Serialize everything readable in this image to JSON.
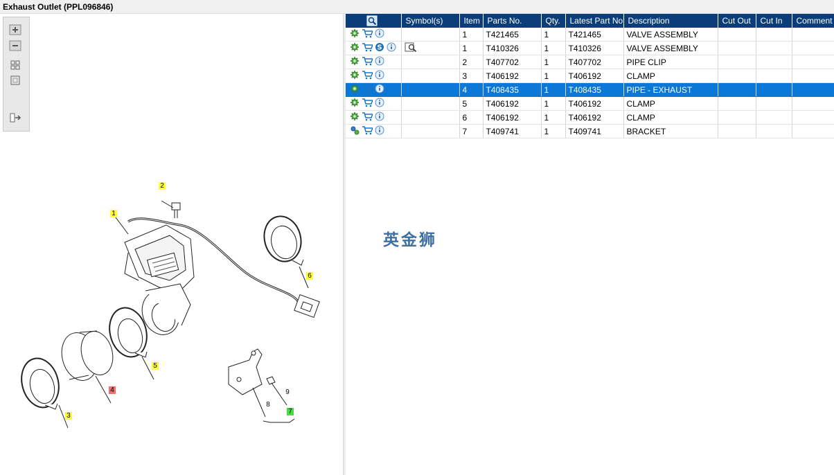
{
  "window": {
    "title": "Exhaust Outlet (PPL096846)"
  },
  "colors": {
    "header_bg": "#0a3d7a",
    "selected_bg": "#0b78d7",
    "label_yellow": "#ffff33",
    "label_red": "#f07070",
    "label_green": "#44dd44"
  },
  "toolbar": {
    "icons": [
      "zoom-in-icon",
      "zoom-out-icon",
      "fit-all-icon",
      "fit-window-icon",
      "export-icon"
    ]
  },
  "table": {
    "columns": [
      "Symbol(s)",
      "Item",
      "Parts No.",
      "Qty.",
      "Latest Part No.",
      "Description",
      "Cut Out",
      "Cut In",
      "Comment"
    ],
    "rows": [
      {
        "item": "1",
        "part": "T421465",
        "qty": "1",
        "latest": "T421465",
        "desc": "VALVE ASSEMBLY",
        "gear": "gear-icon",
        "s": false,
        "sym": false,
        "selected": false
      },
      {
        "item": "1",
        "part": "T410326",
        "qty": "1",
        "latest": "T410326",
        "desc": "VALVE ASSEMBLY",
        "gear": "gear-icon",
        "s": true,
        "sym": true,
        "selected": false
      },
      {
        "item": "2",
        "part": "T407702",
        "qty": "1",
        "latest": "T407702",
        "desc": "PIPE CLIP",
        "gear": "gear-icon",
        "s": false,
        "sym": false,
        "selected": false
      },
      {
        "item": "3",
        "part": "T406192",
        "qty": "1",
        "latest": "T406192",
        "desc": "CLAMP",
        "gear": "gear-icon",
        "s": false,
        "sym": false,
        "selected": false
      },
      {
        "item": "4",
        "part": "T408435",
        "qty": "1",
        "latest": "T408435",
        "desc": "PIPE - EXHAUST",
        "gear": "gear-icon",
        "s": false,
        "sym": false,
        "selected": true
      },
      {
        "item": "5",
        "part": "T406192",
        "qty": "1",
        "latest": "T406192",
        "desc": "CLAMP",
        "gear": "gear-icon",
        "s": false,
        "sym": false,
        "selected": false
      },
      {
        "item": "6",
        "part": "T406192",
        "qty": "1",
        "latest": "T406192",
        "desc": "CLAMP",
        "gear": "gear-icon",
        "s": false,
        "sym": false,
        "selected": false
      },
      {
        "item": "7",
        "part": "T409741",
        "qty": "1",
        "latest": "T409741",
        "desc": "BRACKET",
        "gear": "gears-icon",
        "s": false,
        "sym": false,
        "selected": false
      }
    ]
  },
  "watermark": "英金狮",
  "diagram": {
    "labels": [
      {
        "text": "1",
        "kind": "y"
      },
      {
        "text": "2",
        "kind": "y"
      },
      {
        "text": "3",
        "kind": "y"
      },
      {
        "text": "4",
        "kind": "r"
      },
      {
        "text": "5",
        "kind": "y"
      },
      {
        "text": "6",
        "kind": "y"
      },
      {
        "text": "7",
        "kind": "g"
      },
      {
        "text": "8",
        "kind": "n"
      },
      {
        "text": "9",
        "kind": "n"
      }
    ]
  }
}
